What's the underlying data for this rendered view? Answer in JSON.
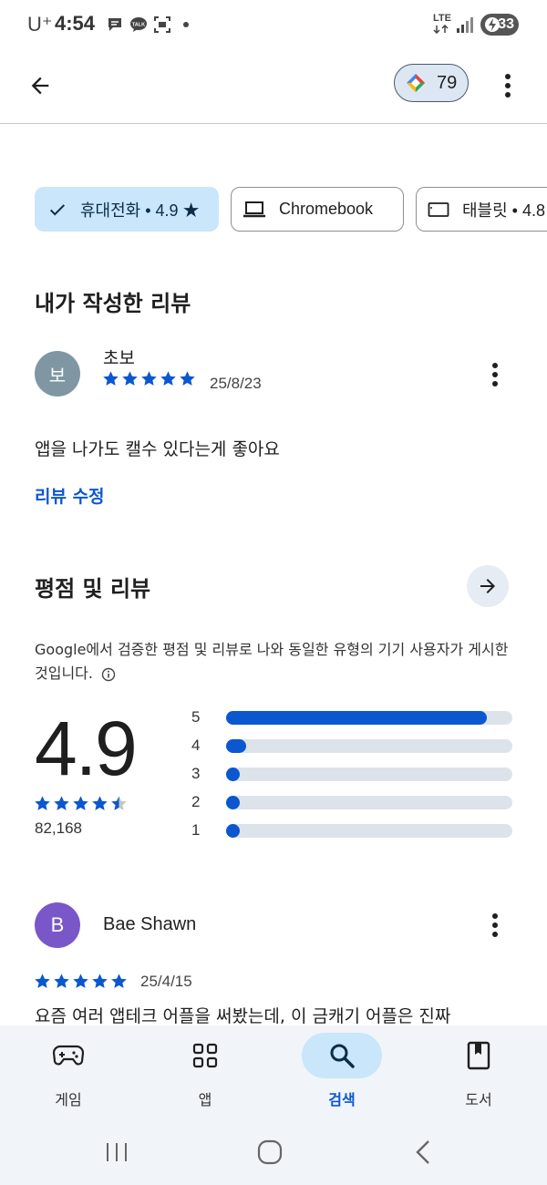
{
  "status_bar": {
    "carrier": "U⁺",
    "time": "4:54",
    "network": "LTE",
    "battery": "33"
  },
  "app_bar": {
    "points": "79"
  },
  "chips": [
    {
      "label": "휴대전화 • 4.9 ★",
      "icon": "check-icon",
      "selected": true
    },
    {
      "label": "Chromebook",
      "icon": "laptop-icon",
      "selected": false
    },
    {
      "label": "태블릿 • 4.8",
      "icon": "tablet-icon",
      "selected": false
    }
  ],
  "my_review": {
    "heading": "내가 작성한 리뷰",
    "avatar_initial": "보",
    "name": "초보",
    "stars": 5,
    "date": "25/8/23",
    "text": "앱을 나가도 캘수 있다는게 좋아요",
    "edit_label": "리뷰 수정"
  },
  "ratings": {
    "heading": "평점 및 리뷰",
    "description": "Google에서 검증한 평점 및 리뷰로 나와 동일한 유형의 기기 사용자가 게시한 것입니다.",
    "average": "4.9",
    "stars": 4.5,
    "count": "82,168",
    "distribution": [
      {
        "label": "5",
        "fraction": 0.91
      },
      {
        "label": "4",
        "fraction": 0.07
      },
      {
        "label": "3",
        "fraction": 0.02
      },
      {
        "label": "2",
        "fraction": 0.02
      },
      {
        "label": "1",
        "fraction": 0.02
      }
    ]
  },
  "review": {
    "avatar_initial": "B",
    "name": "Bae Shawn",
    "stars": 5,
    "date": "25/4/15",
    "text": "요즘 여러 앱테크 어플을 써봤는데, 이 금캐기 어플은 진짜"
  },
  "bottom_nav": [
    {
      "label": "게임",
      "icon": "gamepad-icon"
    },
    {
      "label": "앱",
      "icon": "apps-grid-icon"
    },
    {
      "label": "검색",
      "icon": "search-icon",
      "active": true
    },
    {
      "label": "도서",
      "icon": "book-icon"
    }
  ],
  "colors": {
    "accent": "#0b57d0",
    "chip_selected": "#c9e6fb",
    "nav_bg": "#f1f4f9"
  }
}
